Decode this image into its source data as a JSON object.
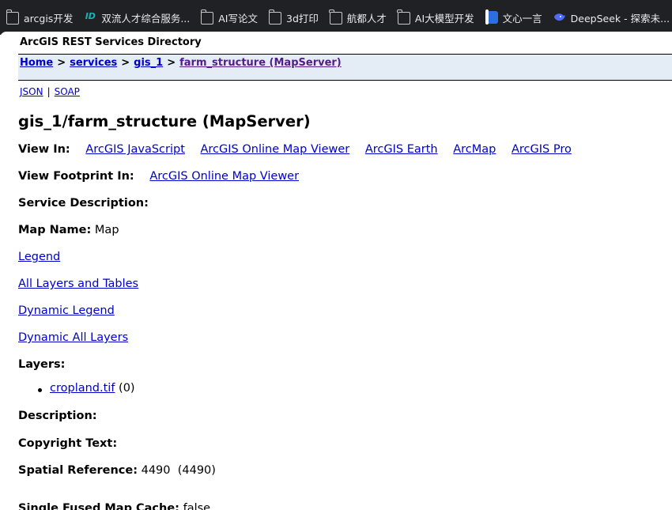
{
  "bookmarks_bar": {
    "items": [
      {
        "label": "arcgis开发",
        "icon": "folder-icon"
      },
      {
        "label": "双流人才综合服务...",
        "icon": "site-favicon"
      },
      {
        "label": "AI写论文",
        "icon": "folder-icon"
      },
      {
        "label": "3d打印",
        "icon": "folder-icon"
      },
      {
        "label": "航都人才",
        "icon": "folder-icon"
      },
      {
        "label": "AI大模型开发",
        "icon": "folder-icon"
      },
      {
        "label": "文心一言",
        "icon": "wenxin-favicon"
      },
      {
        "label": "DeepSeek - 探索未...",
        "icon": "deepseek-favicon"
      }
    ]
  },
  "page": {
    "directory_title": "ArcGIS REST Services Directory",
    "breadcrumb": {
      "home": "Home",
      "services": "services",
      "folder": "gis_1",
      "current": "farm_structure (MapServer)",
      "separator": ">"
    },
    "formats": {
      "json": "JSON",
      "soap": "SOAP",
      "separator": "|"
    },
    "heading": "gis_1/farm_structure (MapServer)",
    "view_in": {
      "label": "View In:",
      "links": [
        "ArcGIS JavaScript",
        "ArcGIS Online Map Viewer",
        "ArcGIS Earth",
        "ArcMap",
        "ArcGIS Pro"
      ]
    },
    "view_footprint": {
      "label": "View Footprint In:",
      "link": "ArcGIS Online Map Viewer"
    },
    "service_description": {
      "label": "Service Description:"
    },
    "map_name": {
      "label": "Map Name:",
      "value": "Map"
    },
    "nav_links": {
      "legend": "Legend",
      "all_layers": "All Layers and Tables",
      "dynamic_legend": "Dynamic Legend",
      "dynamic_all_layers": "Dynamic All Layers"
    },
    "layers": {
      "label": "Layers:",
      "items": [
        {
          "name": "cropland.tif",
          "id": "(0)"
        }
      ]
    },
    "description": {
      "label": "Description:"
    },
    "copyright": {
      "label": "Copyright Text:"
    },
    "spatial_reference": {
      "label": "Spatial Reference:",
      "value": "4490  (4490)"
    },
    "single_fused_cache": {
      "label": "Single Fused Map Cache:",
      "value": "false"
    }
  }
}
